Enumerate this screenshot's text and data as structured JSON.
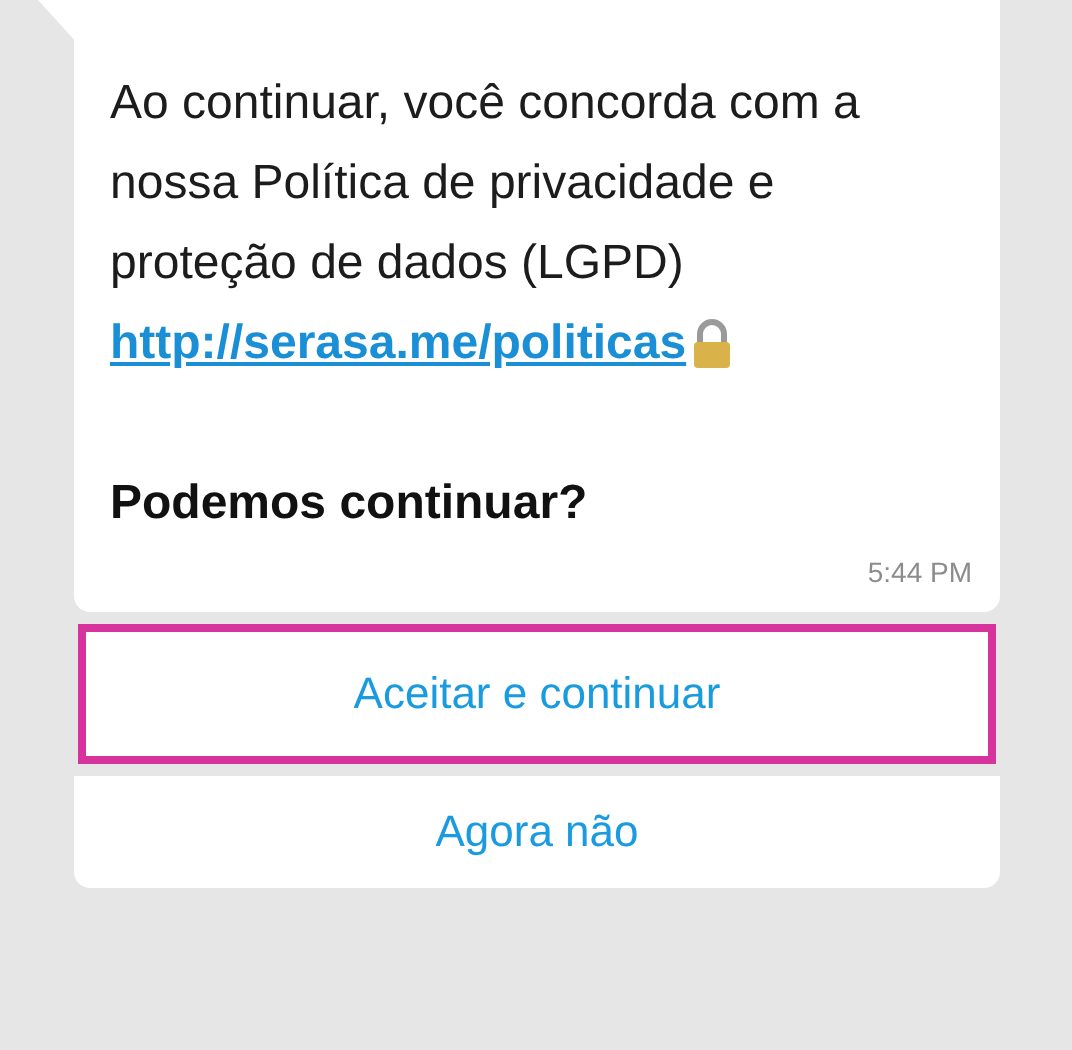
{
  "message": {
    "text": "Ao continuar, você concorda com a nossa Política de privacidade e proteção de dados (LGPD)",
    "link": "http://serasa.me/politicas",
    "question": "Podemos continuar?",
    "time": "5:44 PM"
  },
  "buttons": [
    {
      "label": "Aceitar e continuar",
      "highlighted": true
    },
    {
      "label": "Agora não",
      "highlighted": false
    }
  ]
}
